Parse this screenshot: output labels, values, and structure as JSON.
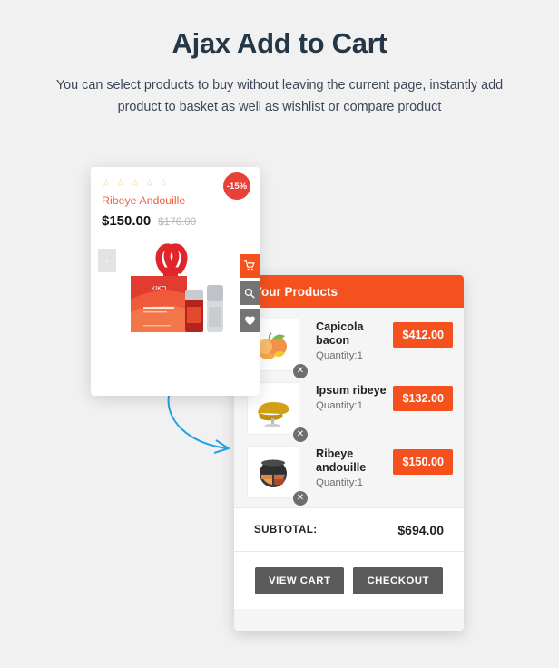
{
  "heading": {
    "title": "Ajax Add to Cart",
    "subtitle": "You can select products to buy without leaving the current page, instantly add product to basket as well as wishlist or compare product"
  },
  "colors": {
    "background": "#f1f1f1",
    "accent_orange": "#f4511e",
    "badge_red": "#e8413a",
    "title_orange": "#f4603e",
    "heading_navy": "#253746",
    "button_gray": "#5b5b5b",
    "star_gold": "#f8c471",
    "arrow_blue": "#21a3e8"
  },
  "product_card": {
    "rating_stars": "☆ ☆ ☆ ☆ ☆",
    "rating_value": 0,
    "rating_max": 5,
    "title": "Ribeye Andouille",
    "price_current": "$150.00",
    "price_old": "$176.00",
    "discount_badge": "-15%",
    "prev_arrow": "‹",
    "actions": [
      {
        "name": "add-to-cart",
        "icon": "cart-icon",
        "style": "accent"
      },
      {
        "name": "quick-view",
        "icon": "search-icon",
        "style": "gray"
      },
      {
        "name": "wishlist",
        "icon": "heart-icon",
        "style": "gray"
      }
    ]
  },
  "cart": {
    "header_title": "Your Products",
    "items": [
      {
        "name": "Capicola bacon",
        "quantity_label": "Quantity:1",
        "price": "$412.00",
        "thumb": "peaches-image",
        "remove_icon": "✕"
      },
      {
        "name": "Ipsum ribeye",
        "quantity_label": "Quantity:1",
        "price": "$132.00",
        "thumb": "armchair-image",
        "remove_icon": "✕"
      },
      {
        "name": "Ribeye andouille",
        "quantity_label": "Quantity:1",
        "price": "$150.00",
        "thumb": "makeup-compact-image",
        "remove_icon": "✕"
      }
    ],
    "subtotal_label": "SUBTOTAL:",
    "subtotal_value": "$694.00",
    "view_cart_label": "VIEW CART",
    "checkout_label": "CHECKOUT"
  }
}
